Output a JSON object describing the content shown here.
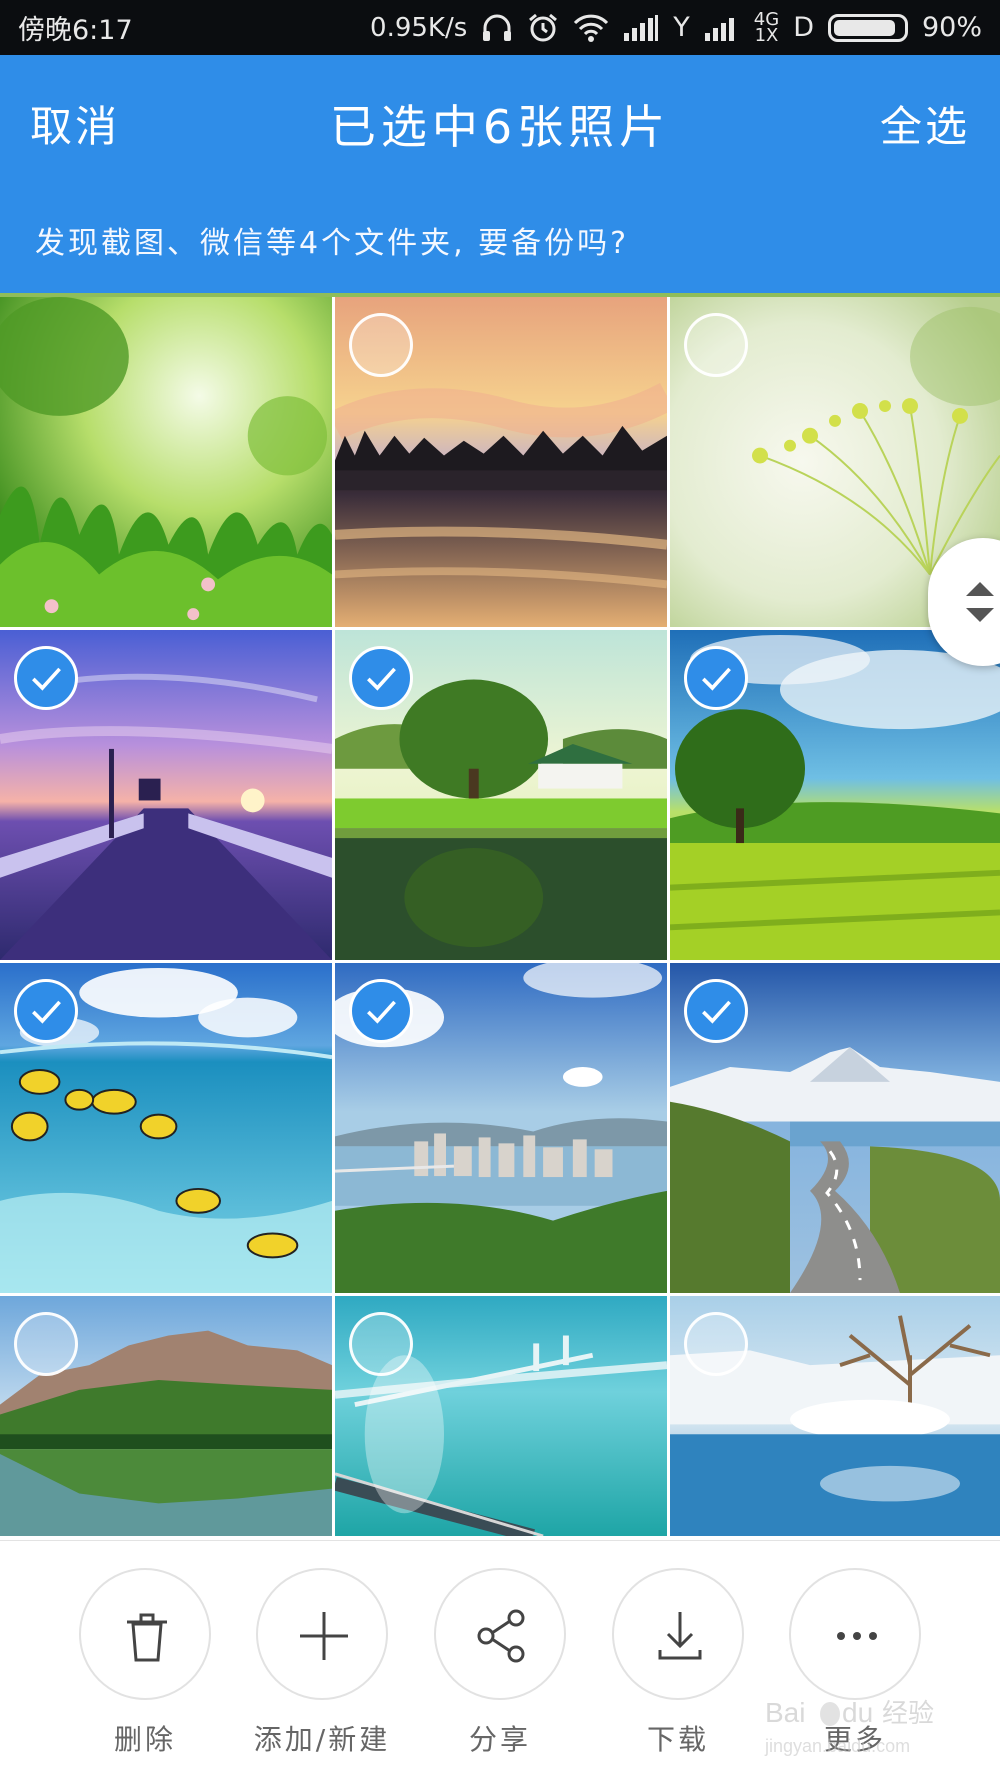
{
  "status_bar": {
    "time": "傍晚6:17",
    "net_speed": "0.95K/s",
    "carrier_y": "Y",
    "net_type_top": "4G",
    "net_type_bottom": "1X",
    "sim2": "D",
    "battery": "90%",
    "battery_level": 0.9
  },
  "header": {
    "cancel": "取消",
    "title": "已选中6张照片",
    "select_all": "全选",
    "backup_tip": "发现截图、微信等4个文件夹, 要备份吗?",
    "color": "#2f8de8"
  },
  "photos": [
    {
      "scene": "green-grass-bokeh",
      "selected": false
    },
    {
      "scene": "sunset-lake",
      "selected": false
    },
    {
      "scene": "dandelion-macro",
      "selected": false
    },
    {
      "scene": "purple-pier-sunset",
      "selected": true
    },
    {
      "scene": "pond-trees-house",
      "selected": true
    },
    {
      "scene": "tree-green-field",
      "selected": true
    },
    {
      "scene": "underwater-fish",
      "selected": true
    },
    {
      "scene": "city-river-aerial",
      "selected": true
    },
    {
      "scene": "mountain-road",
      "selected": true
    },
    {
      "scene": "mountain-lake",
      "selected": false
    },
    {
      "scene": "sea-bridge",
      "selected": false
    },
    {
      "scene": "snowy-tree-lake",
      "selected": false
    }
  ],
  "toolbar": {
    "delete": "删除",
    "add_new": "添加/新建",
    "share": "分享",
    "download": "下载",
    "more": "更多"
  },
  "icons": {
    "headphones": "headphones-icon",
    "alarm": "alarm-icon",
    "wifi": "wifi-icon",
    "signal": "signal-icon",
    "scroll": "scroll-arrows-icon",
    "trash": "trash-icon",
    "plus": "plus-icon",
    "share": "share-icon",
    "download": "download-icon",
    "more": "more-dots-icon"
  },
  "watermark": "Baidu经验 jingyan.baidu.com"
}
